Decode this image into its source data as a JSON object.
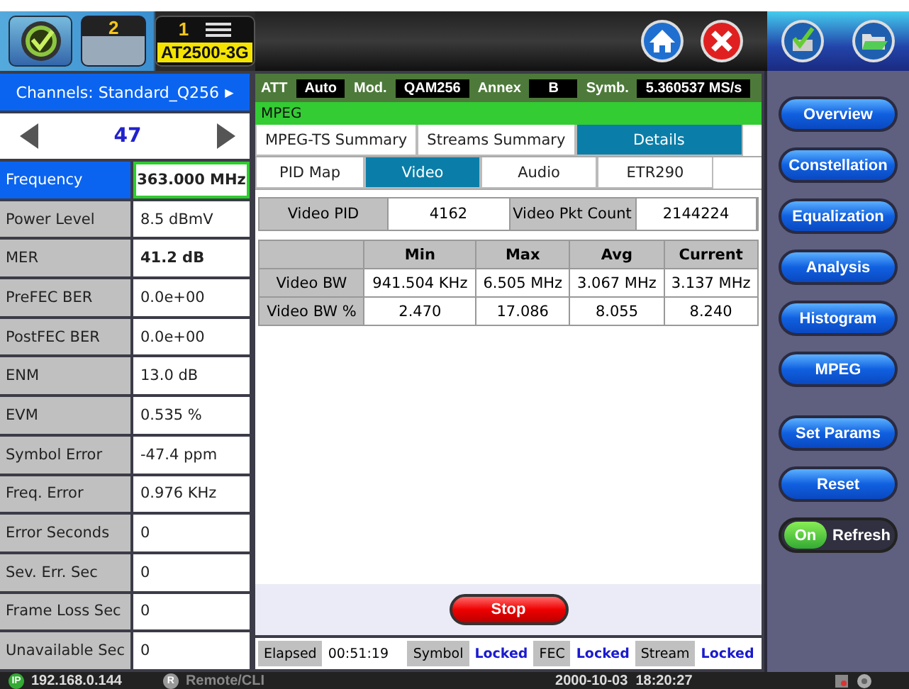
{
  "top_bar": {
    "tab_number": "2",
    "badge": {
      "number": "1",
      "model": "AT2500-3G"
    }
  },
  "channels": {
    "header": "Channels: Standard_Q256",
    "header_arrow": "▶",
    "channel": "47"
  },
  "measurements": [
    {
      "label": "Frequency",
      "value": "363.000 MHz",
      "selected": true,
      "bold": true
    },
    {
      "label": "Power Level",
      "value": "8.5 dBmV",
      "selected": false,
      "bold": false
    },
    {
      "label": "MER",
      "value": "41.2 dB",
      "selected": false,
      "bold": true
    },
    {
      "label": "PreFEC BER",
      "value": "0.0e+00",
      "selected": false,
      "bold": false
    },
    {
      "label": "PostFEC BER",
      "value": "0.0e+00",
      "selected": false,
      "bold": false
    },
    {
      "label": "ENM",
      "value": "13.0 dB",
      "selected": false,
      "bold": false
    },
    {
      "label": "EVM",
      "value": "0.535 %",
      "selected": false,
      "bold": false
    },
    {
      "label": "Symbol Error",
      "value": "-47.4 ppm",
      "selected": false,
      "bold": false
    },
    {
      "label": "Freq. Error",
      "value": "0.976 KHz",
      "selected": false,
      "bold": false
    },
    {
      "label": "Error Seconds",
      "value": "0",
      "selected": false,
      "bold": false
    },
    {
      "label": "Sev. Err. Sec",
      "value": "0",
      "selected": false,
      "bold": false
    },
    {
      "label": "Frame Loss Sec",
      "value": "0",
      "selected": false,
      "bold": false
    },
    {
      "label": "Unavailable Sec",
      "value": "0",
      "selected": false,
      "bold": false
    }
  ],
  "settings_bar": [
    {
      "label": "ATT",
      "value": "Auto"
    },
    {
      "label": "Mod.",
      "value": "QAM256"
    },
    {
      "label": "Annex",
      "value": "B"
    },
    {
      "label": "Symb.",
      "value": "5.360537 MS/s"
    }
  ],
  "section": "MPEG",
  "tabs": [
    {
      "label": "MPEG-TS Summary",
      "selected": false
    },
    {
      "label": "Streams Summary",
      "selected": false
    },
    {
      "label": "Details",
      "selected": true
    }
  ],
  "subtabs": [
    {
      "label": "PID Map",
      "selected": false
    },
    {
      "label": "Video",
      "selected": true
    },
    {
      "label": "Audio",
      "selected": false
    },
    {
      "label": "ETR290",
      "selected": false
    }
  ],
  "pid_info": [
    {
      "label": "Video PID",
      "value": "4162"
    },
    {
      "label": "Video Pkt Count",
      "value": "2144224"
    }
  ],
  "table": {
    "columns": [
      "Min",
      "Max",
      "Avg",
      "Current"
    ],
    "rows": [
      {
        "label": "Video BW",
        "cells": [
          "941.504 KHz",
          "6.505 MHz",
          "3.067 MHz",
          "3.137 MHz"
        ]
      },
      {
        "label": "Video BW %",
        "cells": [
          "2.470",
          "17.086",
          "8.055",
          "8.240"
        ]
      }
    ]
  },
  "stop_button": "Stop",
  "status_row": {
    "elapsed_label": "Elapsed",
    "elapsed": "00:51:19",
    "locks": [
      {
        "label": "Symbol",
        "value": "Locked"
      },
      {
        "label": "FEC",
        "value": "Locked"
      },
      {
        "label": "Stream",
        "value": "Locked"
      }
    ]
  },
  "nav_buttons": [
    "Overview",
    "Constellation",
    "Equalization",
    "Analysis",
    "Histogram",
    "MPEG"
  ],
  "action_buttons": [
    "Set Params",
    "Reset"
  ],
  "refresh_toggle": {
    "on": true,
    "on_label": "On",
    "label": "Refresh"
  },
  "status_bar": {
    "ip_badge": "IP",
    "ip": "192.168.0.144",
    "remote_badge": "R",
    "remote": "Remote/CLI",
    "datetime": "2000-10-03  18:20:27"
  }
}
